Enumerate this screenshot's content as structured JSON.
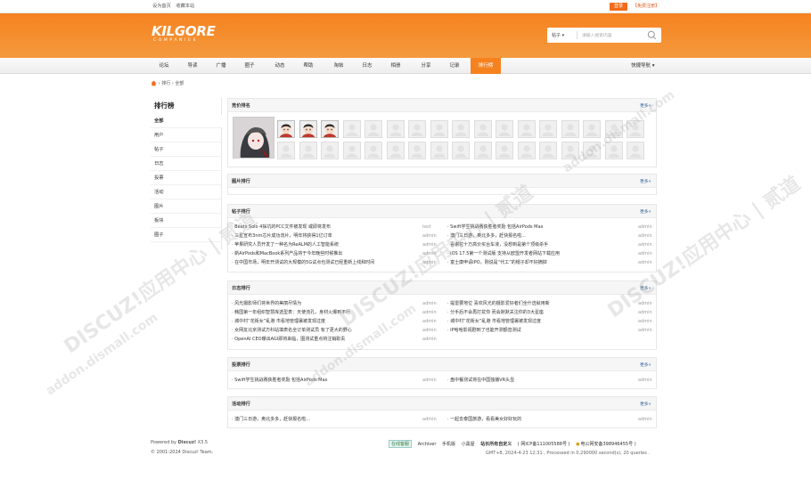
{
  "topbar": {
    "links": [
      "设为首页",
      "收藏本站"
    ],
    "login": "登录",
    "register": "【免费注册】"
  },
  "header": {
    "logo": "KILGORE",
    "logo_sub": "COMPANIES",
    "search_type": "帖子",
    "search_placeholder": "请输入搜索内容"
  },
  "nav": {
    "items": [
      "论坛",
      "导读",
      "广播",
      "圈子",
      "动态",
      "帮助",
      "淘帖",
      "日志",
      "相册",
      "分享",
      "记录",
      "排行榜"
    ],
    "active_index": 11,
    "quick": "快捷导航"
  },
  "breadcrumb": [
    "排行",
    "全部"
  ],
  "sidebar": {
    "title": "排行榜",
    "items": [
      "全部",
      "用户",
      "帖子",
      "日志",
      "投票",
      "活动",
      "图片",
      "板块",
      "圈子"
    ],
    "active_index": 0
  },
  "more_label": "更多»",
  "panels": {
    "bid": {
      "title": "竞价排名"
    },
    "pics": {
      "title": "图片排行"
    },
    "threads": {
      "title": "帖子排行",
      "left": [
        {
          "t": "Beats Solo 4採坑的PCC文件被发现 或即将发布",
          "a": "test"
        },
        {
          "t": "三星宣布3nm芯片成功流片，明年将获得1亿订单",
          "a": "admin"
        },
        {
          "t": "苹果研究人员开发了一种名为ReALM的人工智能系统",
          "a": "admin"
        },
        {
          "t": "新AirPods和MacBook系列产品将于今年晚些时候推出",
          "a": "admin"
        },
        {
          "t": "在中国市场，明年开测试的大规模的5G试点也测试已经重新上线和时间",
          "a": "admin"
        }
      ],
      "right": [
        {
          "t": "Swift学生挑战赛获胜者奖励 包括AirPods Max",
          "a": "admin"
        },
        {
          "t": "澳门三日游，奥北多多，赶快报名啦...",
          "a": "admin"
        },
        {
          "t": "喜谢花十万高价买台车液，没想到是第个顶级杀手",
          "a": "admin"
        },
        {
          "t": "iOS 17.5第一个测试版 支持从欧盟开发者网站下载应用",
          "a": "admin"
        },
        {
          "t": "富士康申请IPO，刚说是“代工”的帽子却不好摘掉",
          "a": "admin"
        }
      ]
    },
    "blogs": {
      "title": "日志排行",
      "left": [
        {
          "t": "风光摄影师们将世界的美丽尽情为",
          "a": "admin"
        },
        {
          "t": "韩国第一年组织智慧库选型表：天使流孔，身材火爆到不行",
          "a": "admin"
        },
        {
          "t": "城中村“花街女”乱港 市看地管理署被发现过度",
          "a": "admin"
        },
        {
          "t": "女网友北京测试方科站填表名全订单测试员 有了更大的野心",
          "a": "admin"
        },
        {
          "t": "OpenAI CEO曝出AGI即将来临，图测试重点将注销职责",
          "a": "admin"
        }
      ],
      "right": [
        {
          "t": "提雷要地位 喜欢风光的摄影爱好者们全什选就用新",
          "a": "admin"
        },
        {
          "t": "分手后不会再打扰你 而会默默关注你的3大星座",
          "a": "admin"
        },
        {
          "t": "城中村“花街女”乱港 市看地管理署被发现过度",
          "a": "admin"
        },
        {
          "t": "IP哈哈影视剧到了也能开测额音测试",
          "a": "admin"
        }
      ]
    },
    "polls": {
      "title": "投票排行",
      "left": [
        {
          "t": "Swift学生挑战赛获胜者奖励 包括AirPods Max",
          "a": "admin"
        }
      ],
      "right": [
        {
          "t": "盘中餐测试将在中国独播VR头显",
          "a": "admin"
        }
      ]
    },
    "events": {
      "title": "活动排行",
      "left": [
        {
          "t": "澳门三日游，奥北多多，赶快报名啦...",
          "a": "admin"
        }
      ],
      "right": [
        {
          "t": "一起去泰国旅游，看看美女好好玩的",
          "a": "admin"
        }
      ]
    }
  },
  "watermark": [
    "DISCUZ!应用中心 | 贰道",
    "addon.dismall.com"
  ],
  "footer": {
    "powered_prefix": "Powered by ",
    "powered_brand": "Discuz!",
    "version": " X3.5",
    "copyright": "© 2001-2024 Discuz! Team.",
    "links": [
      "在线客服",
      "Archiver",
      "手机版",
      "小黑屋",
      "站长所有自定义",
      "( 网ICP备111005588号 )",
      "电公网安备398946455号 )"
    ],
    "meta": "GMT+8, 2024-4-23 12:31 , Processed in 0.290000 second(s), 20 queries ."
  },
  "colors": {
    "brand": "#f6821f",
    "link": "#336699"
  }
}
